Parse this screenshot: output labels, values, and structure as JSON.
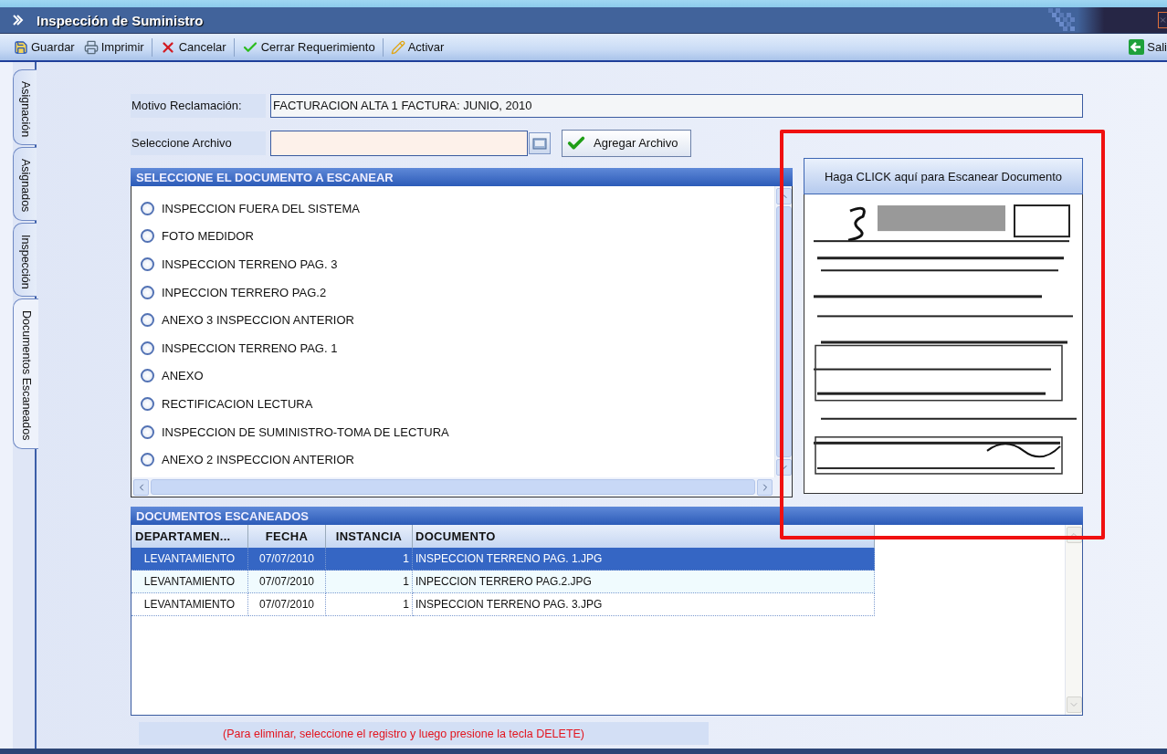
{
  "window": {
    "title": "Inspección de Suministro"
  },
  "toolbar": [
    {
      "kind": "save",
      "label": "Guardar"
    },
    {
      "kind": "print",
      "label": "Imprimir"
    },
    {
      "kind": "separator"
    },
    {
      "kind": "cancel",
      "label": "Cancelar"
    },
    {
      "kind": "separator"
    },
    {
      "kind": "close",
      "label": "Cerrar Requerimiento"
    },
    {
      "kind": "separator"
    },
    {
      "kind": "activate",
      "label": "Activar"
    }
  ],
  "exit": {
    "label": "Sali"
  },
  "side_tabs": [
    {
      "label": "Asignación",
      "selected": false
    },
    {
      "label": "Asignados",
      "selected": false
    },
    {
      "label": "Inspección",
      "selected": false
    },
    {
      "label": "Documentos Escaneados",
      "selected": true
    }
  ],
  "motivo": {
    "label": "Motivo Reclamación:",
    "value": "FACTURACION ALTA 1 FACTURA: JUNIO, 2010"
  },
  "archivo": {
    "label": "Seleccione Archivo",
    "button": "Agregar Archivo"
  },
  "document_types": {
    "title": "SELECCIONE EL DOCUMENTO A ESCANEAR",
    "items": [
      {
        "label": "INSPECCION FUERA DEL SISTEMA",
        "selected": false
      },
      {
        "label": "FOTO MEDIDOR",
        "selected": false
      },
      {
        "label": "INSPECCION TERRENO PAG. 3",
        "selected": false
      },
      {
        "label": "INPECCION TERRERO PAG.2",
        "selected": false
      },
      {
        "label": "ANEXO 3 INSPECCION ANTERIOR",
        "selected": false
      },
      {
        "label": "INSPECCION TERRENO PAG. 1",
        "selected": false
      },
      {
        "label": "ANEXO",
        "selected": false
      },
      {
        "label": "RECTIFICACION LECTURA",
        "selected": false
      },
      {
        "label": "INSPECCION DE SUMINISTRO-TOMA DE LECTURA",
        "selected": false
      },
      {
        "label": "ANEXO 2 INSPECCION ANTERIOR",
        "selected": false
      }
    ]
  },
  "scan": {
    "button": "Haga CLICK aquí para Escanear Documento"
  },
  "scanned": {
    "title": "DOCUMENTOS ESCANEADOS",
    "columns": [
      "DEPARTAMEN...",
      "FECHA",
      "INSTANCIA",
      "DOCUMENTO"
    ],
    "rows": [
      {
        "cells": [
          "LEVANTAMIENTO",
          "07/07/2010",
          "1",
          "INSPECCION TERRENO PAG. 1.JPG"
        ],
        "selected": true
      },
      {
        "cells": [
          "LEVANTAMIENTO",
          "07/07/2010",
          "1",
          "INPECCION TERRERO PAG.2.JPG"
        ],
        "selected": false
      },
      {
        "cells": [
          "LEVANTAMIENTO",
          "07/07/2010",
          "1",
          "INSPECCION TERRENO PAG. 3.JPG"
        ],
        "selected": false
      }
    ]
  },
  "note": "(Para eliminar, seleccione el registro y luego presione la tecla DELETE)"
}
